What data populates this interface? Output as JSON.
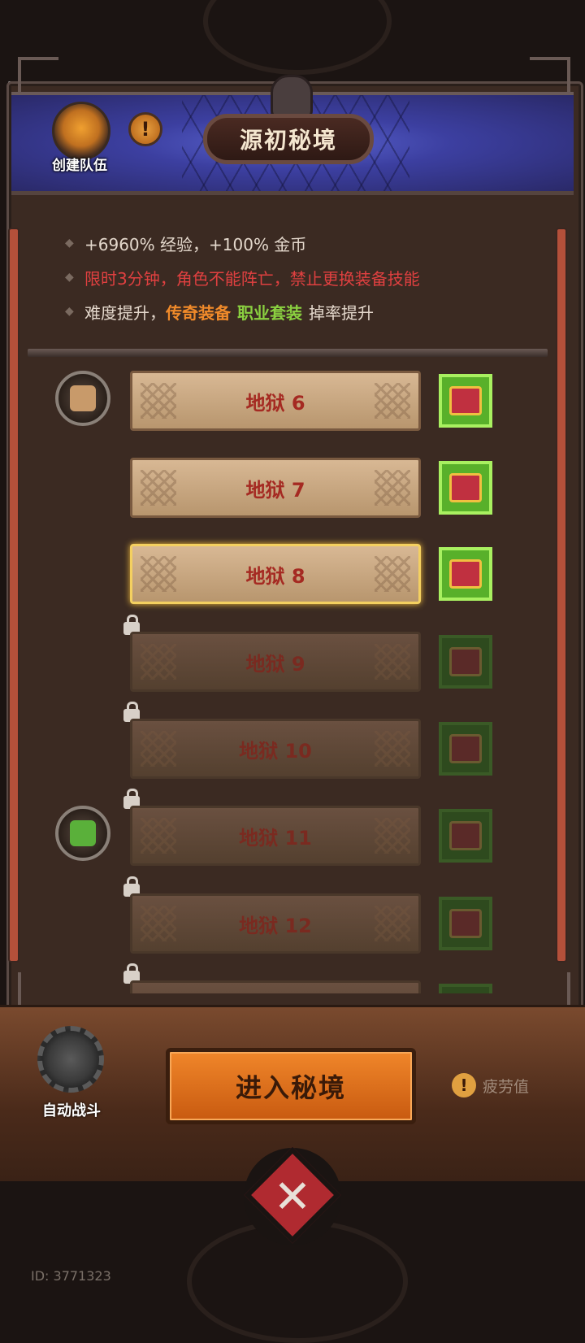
{
  "header": {
    "title": "源初秘境",
    "team_label": "创建队伍",
    "info_symbol": "!"
  },
  "info": {
    "line1": "+6960% 经验，+100% 金币",
    "line2": "限时3分钟，角色不能阵亡，禁止更换装备技能",
    "line3_prefix": "难度提升，",
    "line3_legend": "传奇装备",
    "line3_set": "职业套装",
    "line3_suffix": "掉率提升"
  },
  "levels": [
    {
      "label": "地狱 6",
      "locked": false,
      "selected": false
    },
    {
      "label": "地狱 7",
      "locked": false,
      "selected": false
    },
    {
      "label": "地狱 8",
      "locked": false,
      "selected": true
    },
    {
      "label": "地狱 9",
      "locked": true,
      "selected": false
    },
    {
      "label": "地狱 10",
      "locked": true,
      "selected": false
    },
    {
      "label": "地狱 11",
      "locked": true,
      "selected": false
    },
    {
      "label": "地狱 12",
      "locked": true,
      "selected": false
    }
  ],
  "bottom": {
    "auto_battle": "自动战斗",
    "enter": "进入秘境",
    "fatigue": "疲劳值",
    "fatigue_symbol": "!"
  },
  "close_symbol": "✕",
  "user_id": "ID: 3771323",
  "colors": {
    "accent_orange": "#f08a2a",
    "legend": "#f08a2a",
    "set": "#8ad040",
    "warning": "#e04040"
  }
}
